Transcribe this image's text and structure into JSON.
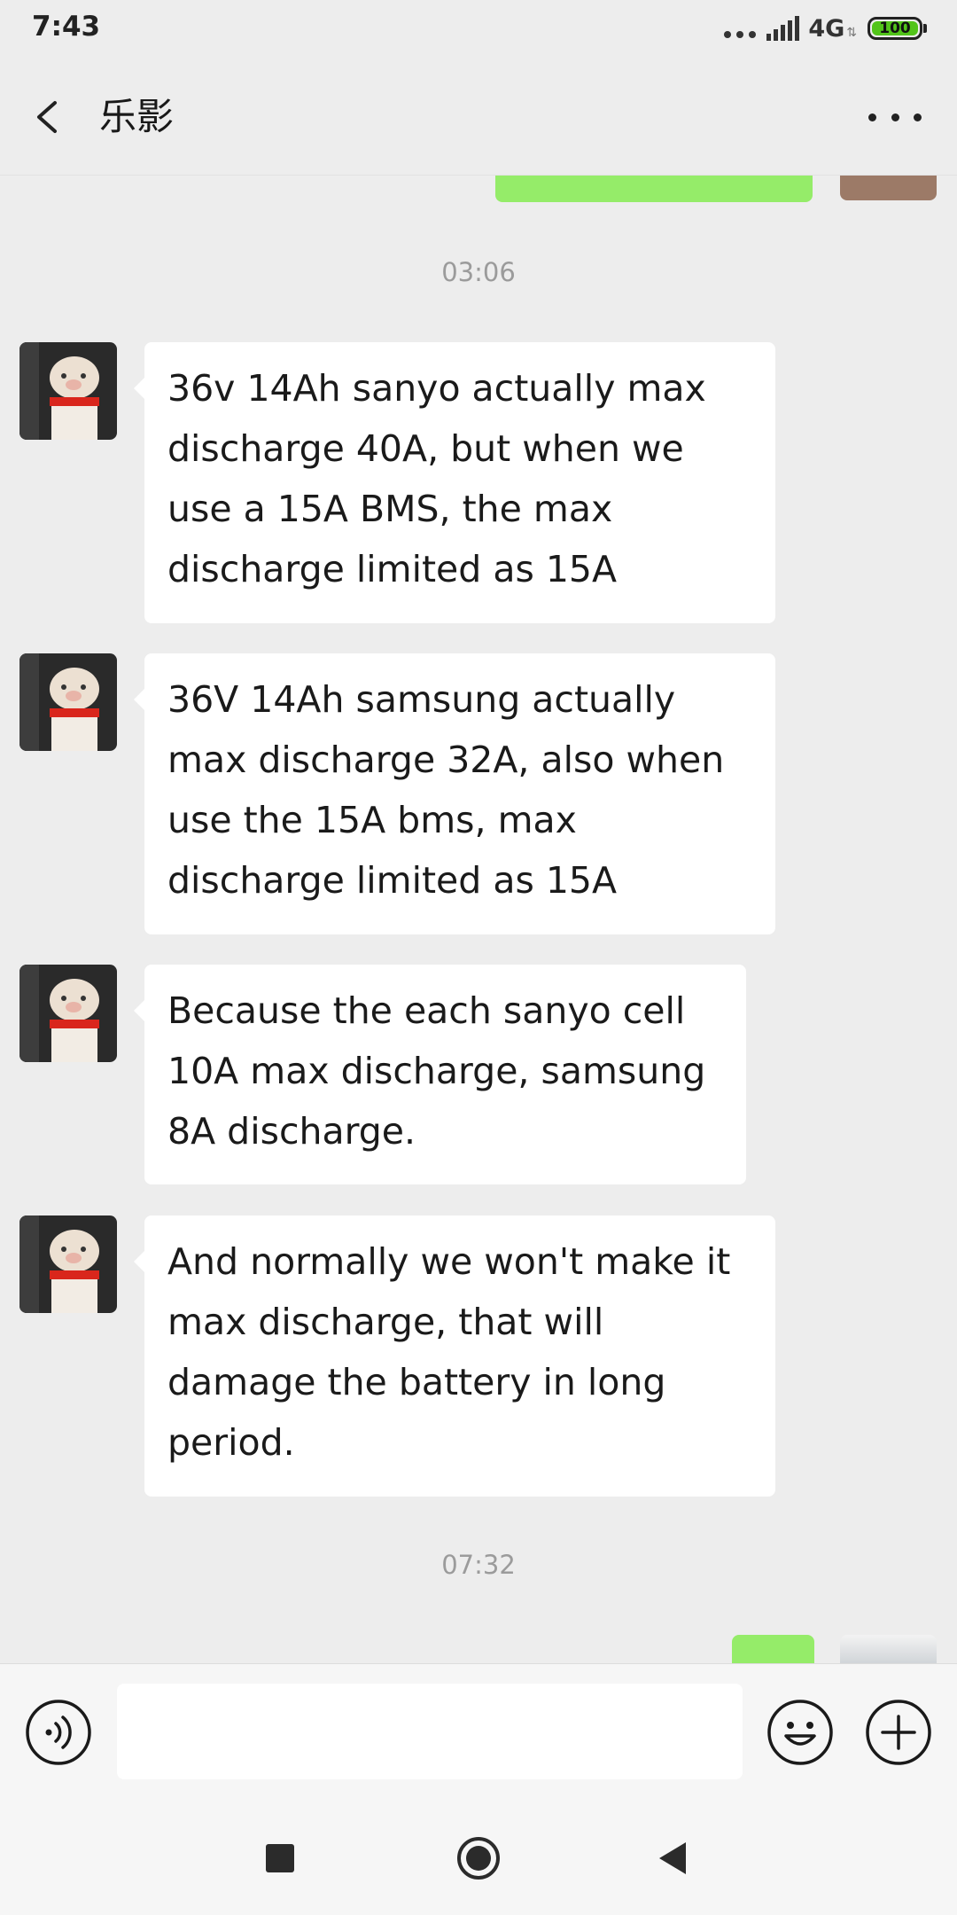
{
  "status_bar": {
    "time": "7:43",
    "network": "4G",
    "battery": "100",
    "battery_color": "#52c41a"
  },
  "header": {
    "title": "乐影",
    "back_icon": "chevron-left-icon",
    "more_icon": "more-horizontal-icon"
  },
  "messages": [
    {
      "type": "time",
      "text": "03:06"
    },
    {
      "type": "received",
      "text": "36v 14Ah sanyo actually max discharge 40A, but when we use a 15A BMS, the max discharge limited as 15A"
    },
    {
      "type": "received",
      "text": "36V 14Ah samsung actually max discharge 32A, also when use the 15A bms, max discharge limited as 15A"
    },
    {
      "type": "received",
      "text": "Because the each sanyo cell 10A max discharge, samsung 8A discharge."
    },
    {
      "type": "received",
      "text": "And normally we won't make it max discharge, that will damage the battery in long period."
    },
    {
      "type": "time",
      "text": "07:32"
    }
  ],
  "input_bar": {
    "value": "",
    "voice_icon": "voice-icon",
    "emoji_icon": "emoji-icon",
    "plus_icon": "plus-icon"
  },
  "colors": {
    "background": "#ededed",
    "sent_bubble": "#95ec69",
    "received_bubble": "#ffffff",
    "timestamp": "#9b9b9b"
  }
}
